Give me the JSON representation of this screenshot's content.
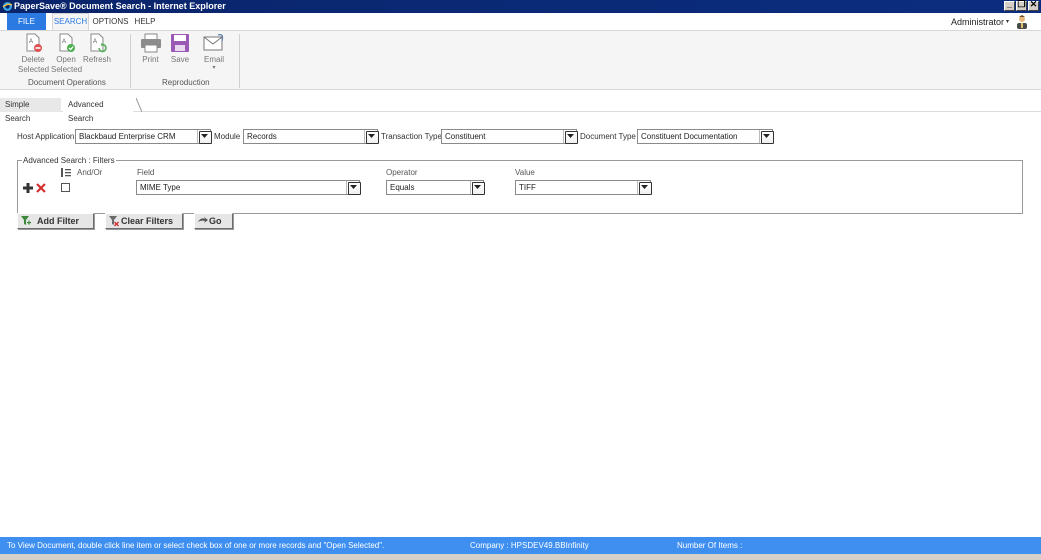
{
  "window": {
    "title": "PaperSave® Document Search - Internet Explorer",
    "buttons": {
      "minimize": "_",
      "restore": "❐",
      "close": "✕"
    }
  },
  "ribbon_tabs": [
    {
      "label": "FILE"
    },
    {
      "label": "SEARCH"
    },
    {
      "label": "OPTIONS"
    },
    {
      "label": "HELP"
    }
  ],
  "user": {
    "name": "Administrator",
    "caret": "▾"
  },
  "ribbon": {
    "document_operations": {
      "label": "Document Operations",
      "buttons": [
        {
          "line1": "Delete",
          "line2": "Selected"
        },
        {
          "line1": "Open",
          "line2": "Selected"
        },
        {
          "line1": "Refresh",
          "line2": ""
        }
      ]
    },
    "reproduction": {
      "label": "Reproduction",
      "buttons": [
        {
          "line1": "Print"
        },
        {
          "line1": "Save"
        },
        {
          "line1": "Email",
          "caret": "▾"
        }
      ]
    }
  },
  "search_tabs": [
    {
      "label": "Simple Search"
    },
    {
      "label": "Advanced Search"
    }
  ],
  "criteria": {
    "host_application": {
      "label": "Host Application",
      "value": "Blackbaud Enterprise CRM"
    },
    "module": {
      "label": "Module",
      "value": "Records"
    },
    "transaction_type": {
      "label": "Transaction Type",
      "value": "Constituent"
    },
    "document_type": {
      "label": "Document Type",
      "value": "Constituent Documentation"
    }
  },
  "filters": {
    "legend": "Advanced Search : Filters",
    "headers": {
      "and_or": "And/Or",
      "field": "Field",
      "operator": "Operator",
      "value": "Value"
    },
    "rows": [
      {
        "field": "MIME Type",
        "operator": "Equals",
        "value": "TIFF",
        "and_or_checked": false
      }
    ]
  },
  "actions": {
    "add_filter": "Add Filter",
    "clear_filters": "Clear Filters",
    "go": "Go"
  },
  "status": {
    "hint": "To View Document, double click line item or select check box of one or more records and \"Open Selected\".",
    "company": "Company : HPSDEV49.BBInfinity",
    "items": "Number Of Items :"
  },
  "colors": {
    "title_bar": "#0a246a",
    "accent": "#2b7ae2",
    "status_bar": "#3f8ff0"
  }
}
